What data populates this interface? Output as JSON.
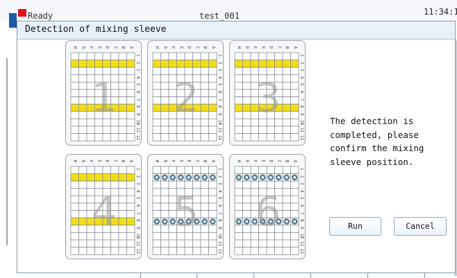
{
  "background": {
    "status_text": "Ready",
    "file_name": "test_001",
    "clock": "11:34:1"
  },
  "dialog": {
    "title": "Detection of mixing sleeve",
    "message": "The detection is completed, please confirm the mixing sleeve position.",
    "run_label": "Run",
    "cancel_label": "Cancel"
  },
  "plate_layout": {
    "column_letters": [
      "H",
      "G",
      "F",
      "E",
      "D",
      "C",
      "B",
      "A"
    ],
    "row_numbers": [
      "1",
      "2",
      "3",
      "4",
      "5",
      "6",
      "7",
      "8",
      "9",
      "10",
      "11",
      "12"
    ]
  },
  "plates": [
    {
      "number": "1",
      "marked_rows": [
        2,
        8
      ],
      "marker": "yellow"
    },
    {
      "number": "2",
      "marked_rows": [
        2,
        8
      ],
      "marker": "yellow"
    },
    {
      "number": "3",
      "marked_rows": [
        2,
        8
      ],
      "marker": "yellow"
    },
    {
      "number": "4",
      "marked_rows": [
        2,
        8
      ],
      "marker": "yellow"
    },
    {
      "number": "5",
      "marked_rows": [
        2,
        8
      ],
      "marker": "sleeve"
    },
    {
      "number": "6",
      "marked_rows": [
        2,
        8
      ],
      "marker": "sleeve"
    }
  ],
  "colors": {
    "yellow_well": "#f2dd16",
    "sleeve_well": "#5b7f96",
    "sleeve_center": "#ffffff"
  }
}
